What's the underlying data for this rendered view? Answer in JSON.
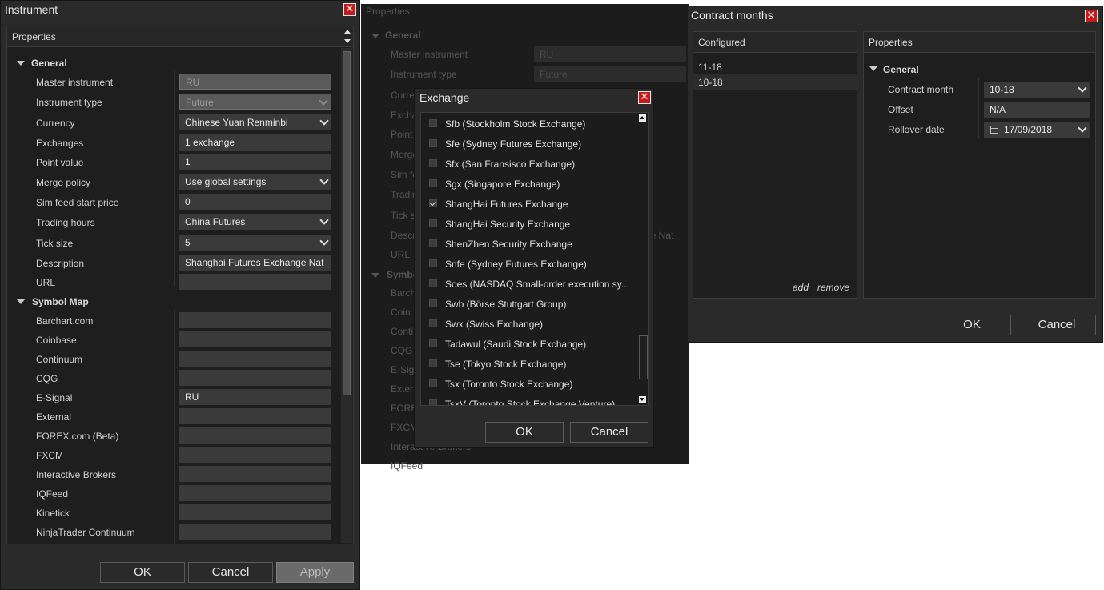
{
  "instrument_window": {
    "title": "Instrument",
    "panel_title": "Properties",
    "sections": [
      {
        "name": "General"
      },
      {
        "name": "Symbol Map"
      }
    ],
    "general": [
      {
        "label": "Master instrument",
        "value": "RU"
      },
      {
        "label": "Instrument type",
        "value": "Future"
      },
      {
        "label": "Currency",
        "value": "Chinese Yuan Renminbi"
      },
      {
        "label": "Exchanges",
        "value": "1 exchange"
      },
      {
        "label": "Point value",
        "value": "1"
      },
      {
        "label": "Merge policy",
        "value": "Use global settings"
      },
      {
        "label": "Sim feed start price",
        "value": "0"
      },
      {
        "label": "Trading hours",
        "value": "China Futures"
      },
      {
        "label": "Tick size",
        "value": "5"
      },
      {
        "label": "Description",
        "value": "Shanghai Futures Exchange Nat"
      },
      {
        "label": "URL",
        "value": ""
      }
    ],
    "symbol_map": [
      {
        "label": "Barchart.com",
        "value": ""
      },
      {
        "label": "Coinbase",
        "value": ""
      },
      {
        "label": "Continuum",
        "value": ""
      },
      {
        "label": "CQG",
        "value": ""
      },
      {
        "label": "E-Signal",
        "value": "RU"
      },
      {
        "label": "External",
        "value": ""
      },
      {
        "label": "FOREX.com (Beta)",
        "value": ""
      },
      {
        "label": "FXCM",
        "value": ""
      },
      {
        "label": "Interactive Brokers",
        "value": ""
      },
      {
        "label": "IQFeed",
        "value": ""
      },
      {
        "label": "Kinetick",
        "value": ""
      },
      {
        "label": "NinjaTrader Continuum",
        "value": ""
      }
    ],
    "buttons": {
      "ok": "OK",
      "cancel": "Cancel",
      "apply": "Apply"
    }
  },
  "background_window": {
    "panel_title": "Properties",
    "section_general": "General",
    "section_symbol": "Symbo",
    "labels": [
      "Master instrument",
      "Instrument type",
      "Curre",
      "Excha",
      "Point",
      "Merge",
      "Sim fe",
      "Tradin",
      "Tick s",
      "Descr",
      "URL",
      "Barch",
      "Coin",
      "Conti",
      "CQG",
      "E-Sig",
      "Exter",
      "FORE",
      "FXCM",
      "Interactive Brokers",
      "IQFeed"
    ],
    "values": {
      "master": "RU",
      "type": "Future",
      "desc_tail": "ge Nat"
    }
  },
  "exchange_dialog": {
    "title": "Exchange",
    "items": [
      {
        "label": "Sfb (Stockholm Stock Exchange)",
        "checked": false
      },
      {
        "label": "Sfe (Sydney Futures Exchange)",
        "checked": false
      },
      {
        "label": "Sfx (San Fransisco Exchange)",
        "checked": false
      },
      {
        "label": "Sgx (Singapore Exchange)",
        "checked": false
      },
      {
        "label": "ShangHai Futures Exchange",
        "checked": true
      },
      {
        "label": "ShangHai Security Exchange",
        "checked": false
      },
      {
        "label": "ShenZhen Security Exchange",
        "checked": false
      },
      {
        "label": "Snfe (Sydney Futures Exchange)",
        "checked": false
      },
      {
        "label": "Soes (NASDAQ Small-order execution sy...",
        "checked": false
      },
      {
        "label": "Swb (Börse Stuttgart Group)",
        "checked": false
      },
      {
        "label": "Swx (Swiss Exchange)",
        "checked": false
      },
      {
        "label": "Tadawul (Saudi Stock Exchange)",
        "checked": false
      },
      {
        "label": "Tse (Tokyo Stock Exchange)",
        "checked": false
      },
      {
        "label": "Tsx (Toronto Stock Exchange)",
        "checked": false
      },
      {
        "label": "TsxV (Toronto Stock Exchange Venture)",
        "checked": false
      }
    ],
    "buttons": {
      "ok": "OK",
      "cancel": "Cancel"
    }
  },
  "contract_window": {
    "title": "Contract months",
    "configured_title": "Configured",
    "configured": [
      "11-18",
      "10-18"
    ],
    "add": "add",
    "remove": "remove",
    "properties_title": "Properties",
    "section_general": "General",
    "props": [
      {
        "label": "Contract month",
        "value": "10-18"
      },
      {
        "label": "Offset",
        "value": "N/A"
      },
      {
        "label": "Rollover date",
        "value": "17/09/2018"
      }
    ],
    "buttons": {
      "ok": "OK",
      "cancel": "Cancel"
    }
  }
}
